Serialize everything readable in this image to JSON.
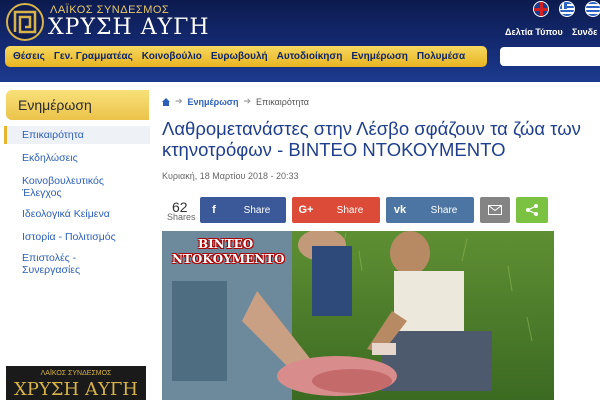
{
  "header": {
    "logo_subtitle": "ΛΑΪΚΟΣ ΣΥΝΔΕΣΜΟΣ",
    "logo_title": "ΧΡΥΣΗ ΑΥΓΗ",
    "links": [
      "Δελτία Τύπου",
      "Συνδε"
    ]
  },
  "nav": {
    "items": [
      "Θέσεις",
      "Γεν. Γραμματέας",
      "Κοινοβούλιο",
      "Ευρωβουλή",
      "Αυτοδιοίκηση",
      "Ενημέρωση",
      "Πολυμέσα"
    ]
  },
  "sidebar": {
    "heading": "Ενημέρωση",
    "items": [
      "Επικαιρότητα",
      "Εκδηλώσεις",
      "Κοινοβουλευτικός Έλεγχος",
      "Ιδεολογικά Κείμενα",
      "Ιστορία - Πολιτισμός",
      "Επιστολές - Συνεργασίες"
    ],
    "active_index": 0,
    "ad": {
      "subtitle": "ΛΑΪΚΟΣ ΣΥΝΔΕΣΜΟΣ",
      "title": "ΧΡΥΣΗ ΑΥΓΗ"
    }
  },
  "breadcrumb": {
    "section": "Ενημέρωση",
    "current": "Επικαιρότητα"
  },
  "article": {
    "title": "Λαθρομετανάστες στην Λέσβο σφάζουν τα ζώα των κτηνοτρόφων - ΒΙΝΤΕΟ ΝΤΟΚΟΥΜΕΝΤΟ",
    "date": "Κυριακή, 18 Μαρτίου 2018 - 20:33",
    "image_label_line1": "ΒΙΝΤΕΟ",
    "image_label_line2": "ΝΤΟΚΟΥΜΕΝΤΟ"
  },
  "share": {
    "count": "62",
    "count_label": "Shares",
    "facebook": "Share",
    "googleplus": "Share",
    "vk": "Share",
    "colors": {
      "facebook": "#3b5998",
      "googleplus": "#dc4a38",
      "vk": "#4c75a3",
      "email": "#848484",
      "more": "#7cc242"
    }
  },
  "icons": [
    "home-icon",
    "facebook-icon",
    "googleplus-icon",
    "vk-icon",
    "email-icon",
    "share-icon",
    "english-flag-icon",
    "greek-flag-icon"
  ]
}
